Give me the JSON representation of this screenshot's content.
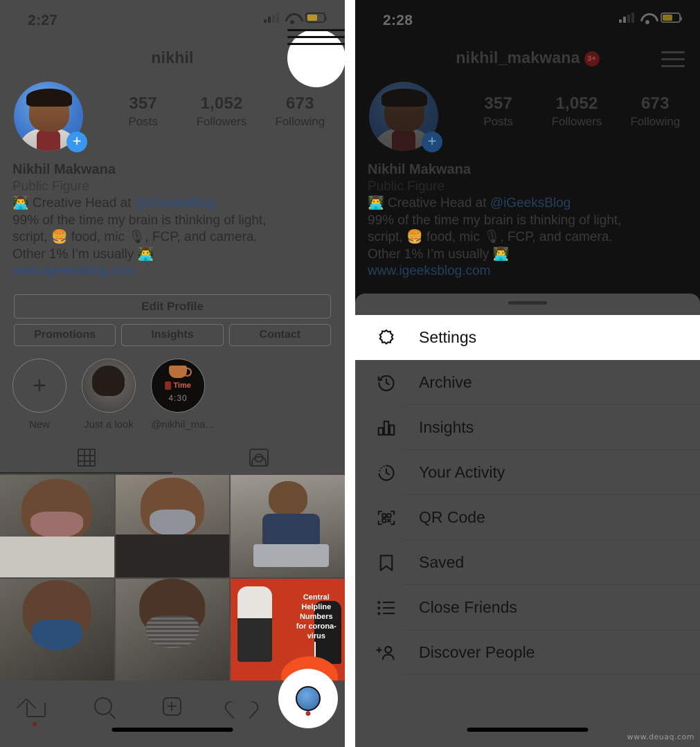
{
  "left_phone": {
    "status_bar": {
      "time": "2:27",
      "signal_icon": "cellular-bars-icon",
      "wifi_icon": "wifi-icon",
      "battery_icon": "battery-icon"
    },
    "header": {
      "username": "nikhil",
      "menu_icon": "hamburger-menu-icon"
    },
    "stats": [
      {
        "number": "357",
        "label": "Posts"
      },
      {
        "number": "1,052",
        "label": "Followers"
      },
      {
        "number": "673",
        "label": "Following"
      }
    ],
    "bio": {
      "name": "Nikhil Makwana",
      "category": "Public Figure",
      "line1_prefix": "👨‍💻 Creative Head at ",
      "line1_mention": "@iGeeksBlog",
      "line2": "99% of the time my brain is thinking of light,",
      "line3": "script, 🍔 food, mic 🎙, FCP, and camera.",
      "line4": "Other 1% I’m usually 👨‍💻",
      "website": "www.igeeksblog.com"
    },
    "actions": {
      "edit_profile": "Edit Profile",
      "secondary": [
        "Promotions",
        "Insights",
        "Contact"
      ]
    },
    "highlights": [
      {
        "caption": "New",
        "type": "new"
      },
      {
        "caption": "Just a look",
        "type": "photo"
      },
      {
        "caption": "@nikhil_ma...",
        "type": "story",
        "overlay_text": "Time",
        "overlay_number": "4:30"
      }
    ],
    "tabs": [
      {
        "name": "grid-tab",
        "icon": "grid-icon",
        "active": true
      },
      {
        "name": "tagged-tab",
        "icon": "tagged-person-icon",
        "active": false
      }
    ],
    "bottom_nav": [
      {
        "name": "home",
        "icon": "home-icon",
        "has_dot": true
      },
      {
        "name": "search",
        "icon": "search-icon",
        "has_dot": false
      },
      {
        "name": "create",
        "icon": "plus-square-icon",
        "has_dot": false
      },
      {
        "name": "activity",
        "icon": "heart-icon",
        "has_dot": false
      },
      {
        "name": "profile",
        "icon": "profile-avatar-icon",
        "has_dot": true
      }
    ]
  },
  "right_phone": {
    "status_bar": {
      "time": "2:28"
    },
    "header": {
      "username": "nikhil_makwana",
      "badge": "3+",
      "menu_icon": "hamburger-menu-icon"
    },
    "stats": [
      {
        "number": "357",
        "label": "Posts"
      },
      {
        "number": "1,052",
        "label": "Followers"
      },
      {
        "number": "673",
        "label": "Following"
      }
    ],
    "bio": {
      "name": "Nikhil Makwana",
      "category": "Public Figure",
      "line1_prefix": "👨‍💻 Creative Head at ",
      "line1_mention": "@iGeeksBlog",
      "line2": "99% of the time my brain is thinking of light,",
      "line3": "script, 🍔 food, mic 🎙, FCP, and camera.",
      "line4": "Other 1% I’m usually 👨‍💻",
      "website": "www.igeeksblog.com"
    },
    "drawer": {
      "handle": "drag-handle",
      "items": [
        {
          "label": "Settings",
          "icon": "gear-icon",
          "highlighted": true
        },
        {
          "label": "Archive",
          "icon": "archive-clock-icon",
          "highlighted": false
        },
        {
          "label": "Insights",
          "icon": "bar-chart-icon",
          "highlighted": false
        },
        {
          "label": "Your Activity",
          "icon": "activity-clock-icon",
          "highlighted": false
        },
        {
          "label": "QR Code",
          "icon": "qr-code-icon",
          "highlighted": false
        },
        {
          "label": "Saved",
          "icon": "bookmark-icon",
          "highlighted": false
        },
        {
          "label": "Close Friends",
          "icon": "star-list-icon",
          "highlighted": false
        },
        {
          "label": "Discover People",
          "icon": "add-person-icon",
          "highlighted": false
        }
      ]
    }
  },
  "watermark": "www.deuaq.com",
  "colors": {
    "dim_overlay": "#4a4a4a",
    "dark_overlay": "#111111",
    "accent_blue": "#3897f0",
    "link_blue": "#2a4d87",
    "badge_red": "#7a1f1f",
    "spotlight": "#ffffff"
  }
}
